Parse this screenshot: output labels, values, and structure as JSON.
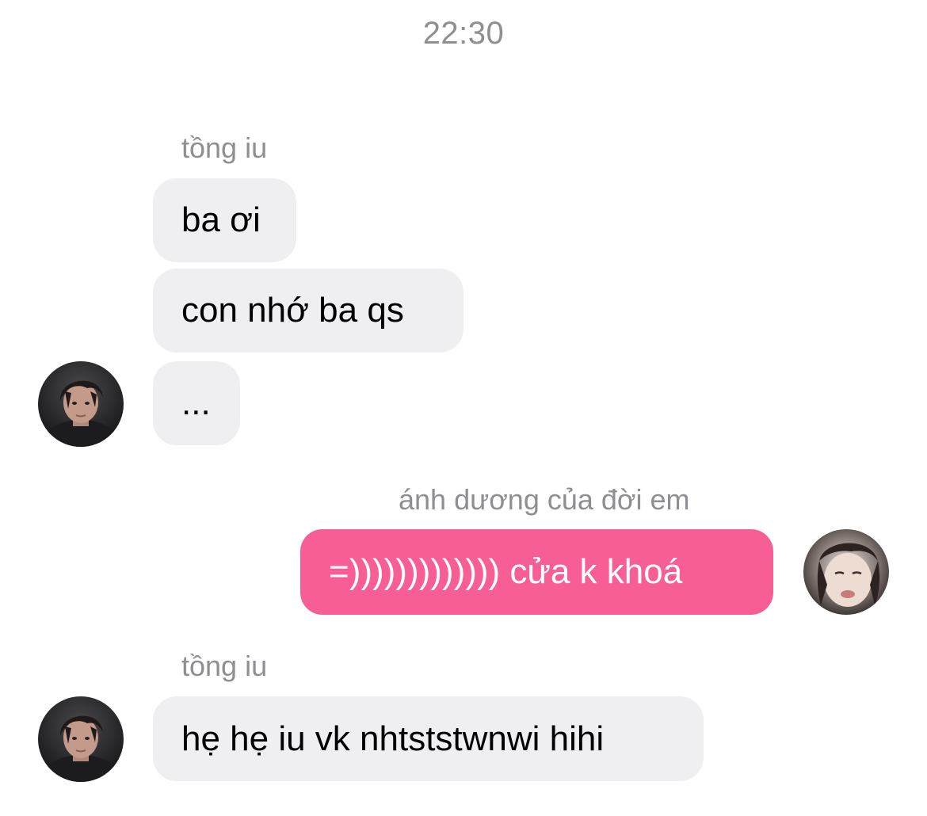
{
  "chat": {
    "timestamp": "22:30",
    "groups": [
      {
        "sender": "tồng iu",
        "direction": "incoming",
        "avatar": "male-avatar-icon",
        "messages": [
          "ba ơi",
          "con nhớ ba qs",
          "..."
        ]
      },
      {
        "sender": "ánh dương của đời em",
        "direction": "outgoing",
        "avatar": "female-avatar-icon",
        "messages": [
          "=))))))))))))) cửa k khoá"
        ]
      },
      {
        "sender": "tồng iu",
        "direction": "incoming",
        "avatar": "male-avatar-icon",
        "messages": [
          "hẹ hẹ iu vk nhtststwnwi hihi"
        ]
      }
    ]
  },
  "colors": {
    "incoming_bubble": "#efeff2",
    "outgoing_bubble": "#f75e96",
    "meta_text": "#8e8e93"
  }
}
